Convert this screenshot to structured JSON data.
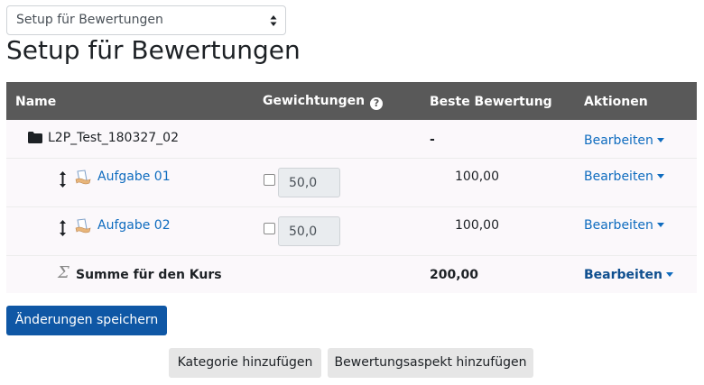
{
  "selector": {
    "value": "Setup für Bewertungen"
  },
  "page_title": "Setup für Bewertungen",
  "table": {
    "headers": {
      "name": "Name",
      "weights": "Gewichtungen",
      "best_grade": "Beste Bewertung",
      "actions": "Aktionen"
    },
    "category": {
      "name": "L2P_Test_180327_02",
      "best_grade": "-",
      "action": "Bearbeiten"
    },
    "items": [
      {
        "name": "Aufgabe 01",
        "weight": "50,0",
        "best_grade": "100,00",
        "action": "Bearbeiten"
      },
      {
        "name": "Aufgabe 02",
        "weight": "50,0",
        "best_grade": "100,00",
        "action": "Bearbeiten"
      }
    ],
    "total": {
      "name": "Summe für den Kurs",
      "best_grade": "200,00",
      "action": "Bearbeiten"
    }
  },
  "buttons": {
    "save": "Änderungen speichern",
    "add_category": "Kategorie hinzufügen",
    "add_grade_item": "Bewertungsaspekt hinzufügen"
  },
  "colors": {
    "header_bg": "#595959",
    "link": "#0f6cbf",
    "primary_button": "#0f57a5"
  }
}
